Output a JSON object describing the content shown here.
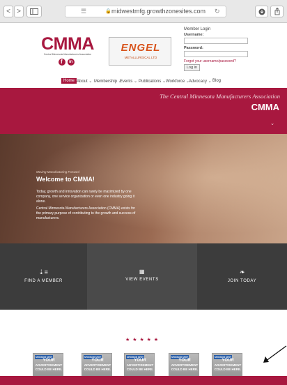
{
  "browser": {
    "url": "midwestmfg.growthzonesites.com"
  },
  "header": {
    "logo_text": "CMMA",
    "logo_subtext": "Central Minnesota Manufacturers Association",
    "sponsor_name": "ENGEL",
    "sponsor_sub": "METALLURGICAL LTD",
    "login": {
      "title": "Member Login",
      "username_label": "Username:",
      "password_label": "Password:",
      "forgot_link": "Forgot your username/password?",
      "login_button": "Log in"
    }
  },
  "nav": {
    "items": [
      {
        "label": "Home"
      },
      {
        "label": "About ⌄"
      },
      {
        "label": "Membership ⌄"
      },
      {
        "label": "Events ⌄"
      },
      {
        "label": "Publications ⌄"
      },
      {
        "label": "Workforce ⌄"
      },
      {
        "label": "Advocacy ⌄"
      },
      {
        "label": "Blog"
      }
    ]
  },
  "hero": {
    "tagline": "The Central Minnesota Manufacturers Association",
    "acronym": "CMMA"
  },
  "welcome": {
    "kicker": "Moving Manufacturing Forward",
    "title": "Welcome to CMMA!",
    "para1": "Today, growth and innovation can rarely be maximized by one company, one service organization or even one industry going it alone.",
    "para2": "Central Minnesota Manufacturers Association (CMMA) exists for the primary purpose of contributing to the growth and success of manufacturers."
  },
  "tiles": [
    {
      "label": "FIND A MEMBER",
      "icon": "list-icon"
    },
    {
      "label": "VIEW EVENTS",
      "icon": "calendar-icon"
    },
    {
      "label": "JOIN TODAY",
      "icon": "leaf-icon"
    }
  ],
  "ads": {
    "stars": "★ ★ ★ ★ ★",
    "badge": "SPONSOR SPOT",
    "line1": "YOUR",
    "line2": "ADVERTISEMENT",
    "line3": "COULD BE HERE."
  },
  "colors": {
    "brand": "#a8183f",
    "tile_dark": "#3a3a3a",
    "tile_mid": "#4a4a4a"
  }
}
